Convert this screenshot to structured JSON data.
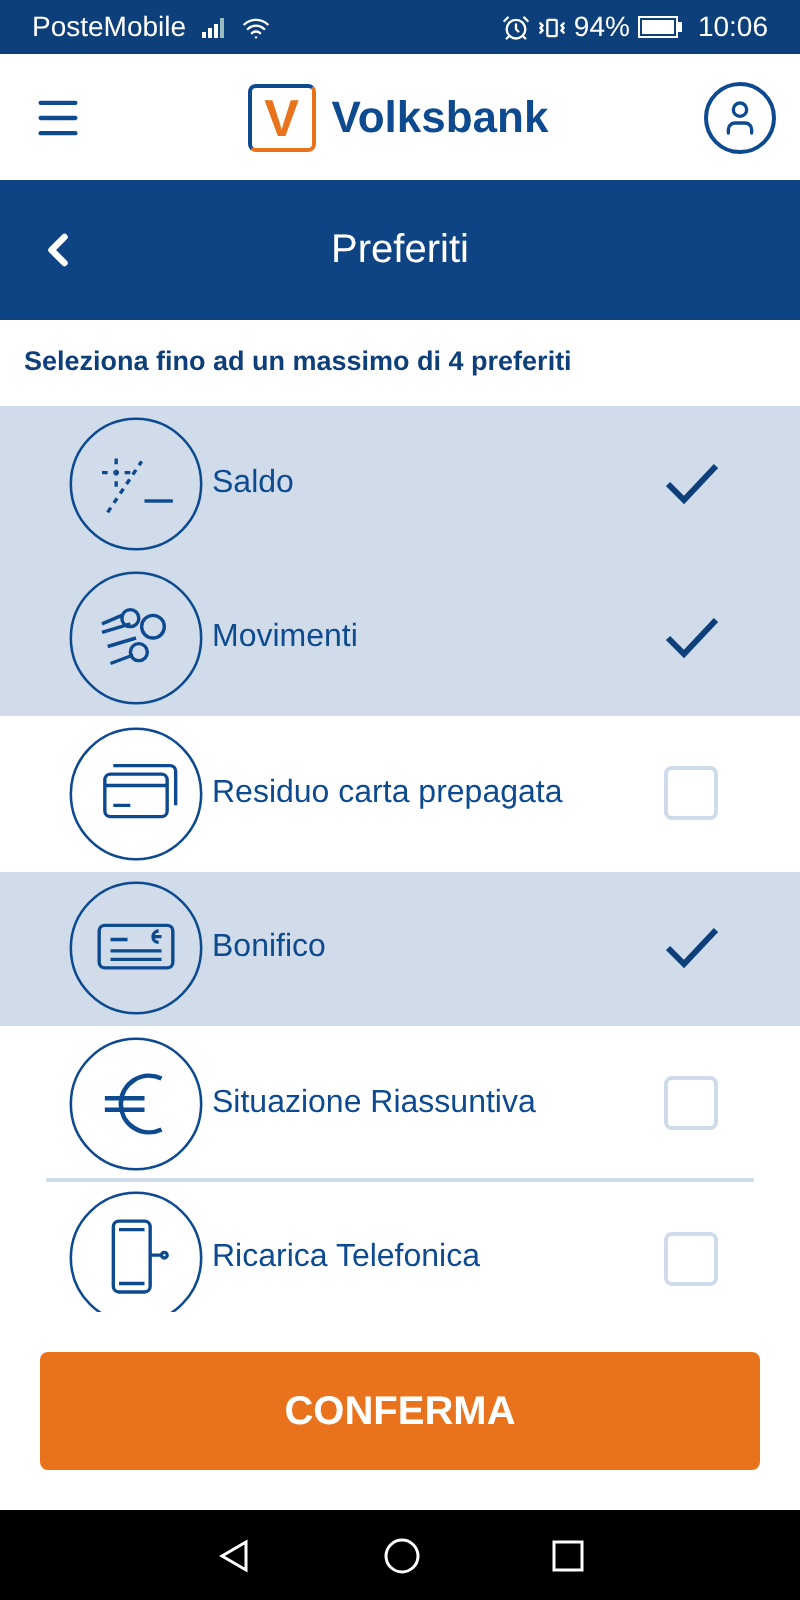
{
  "status_bar": {
    "carrier": "PosteMobile",
    "battery": "94%",
    "time": "10:06"
  },
  "header": {
    "brand": "Volksbank",
    "logo_letter": "V"
  },
  "title_bar": {
    "title": "Preferiti"
  },
  "hint": "Seleziona fino ad un massimo di 4 preferiti",
  "items": [
    {
      "label": "Saldo",
      "kind": "balance",
      "checked": true
    },
    {
      "label": "Movimenti",
      "kind": "coins",
      "checked": true
    },
    {
      "label": "Residuo carta prepagata",
      "kind": "cards",
      "checked": false
    },
    {
      "label": "Bonifico",
      "kind": "transfer",
      "checked": true
    },
    {
      "label": "Situazione Riassuntiva",
      "kind": "euro",
      "checked": false
    },
    {
      "label": "Ricarica Telefonica",
      "kind": "phone",
      "checked": false
    }
  ],
  "confirm_button": "CONFERMA"
}
